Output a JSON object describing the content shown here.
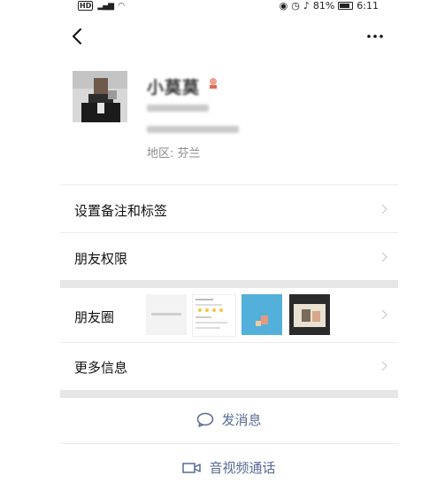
{
  "status_bar": {
    "network": "4G",
    "battery": "81%",
    "time": "6:11"
  },
  "nav": {
    "back_icon": "chevron-left-icon",
    "more_label": "···"
  },
  "profile": {
    "name": "小莫莫",
    "region": "地区: 芬兰"
  },
  "menu": {
    "remark_tags": "设置备注和标签",
    "friend_permissions": "朋友权限",
    "moments": "朋友圈",
    "more_info": "更多信息"
  },
  "actions": {
    "send_message": "发消息",
    "video_call": "音视频通话"
  },
  "colors": {
    "link": "#576b95",
    "section_gap": "#e6e6e6"
  }
}
